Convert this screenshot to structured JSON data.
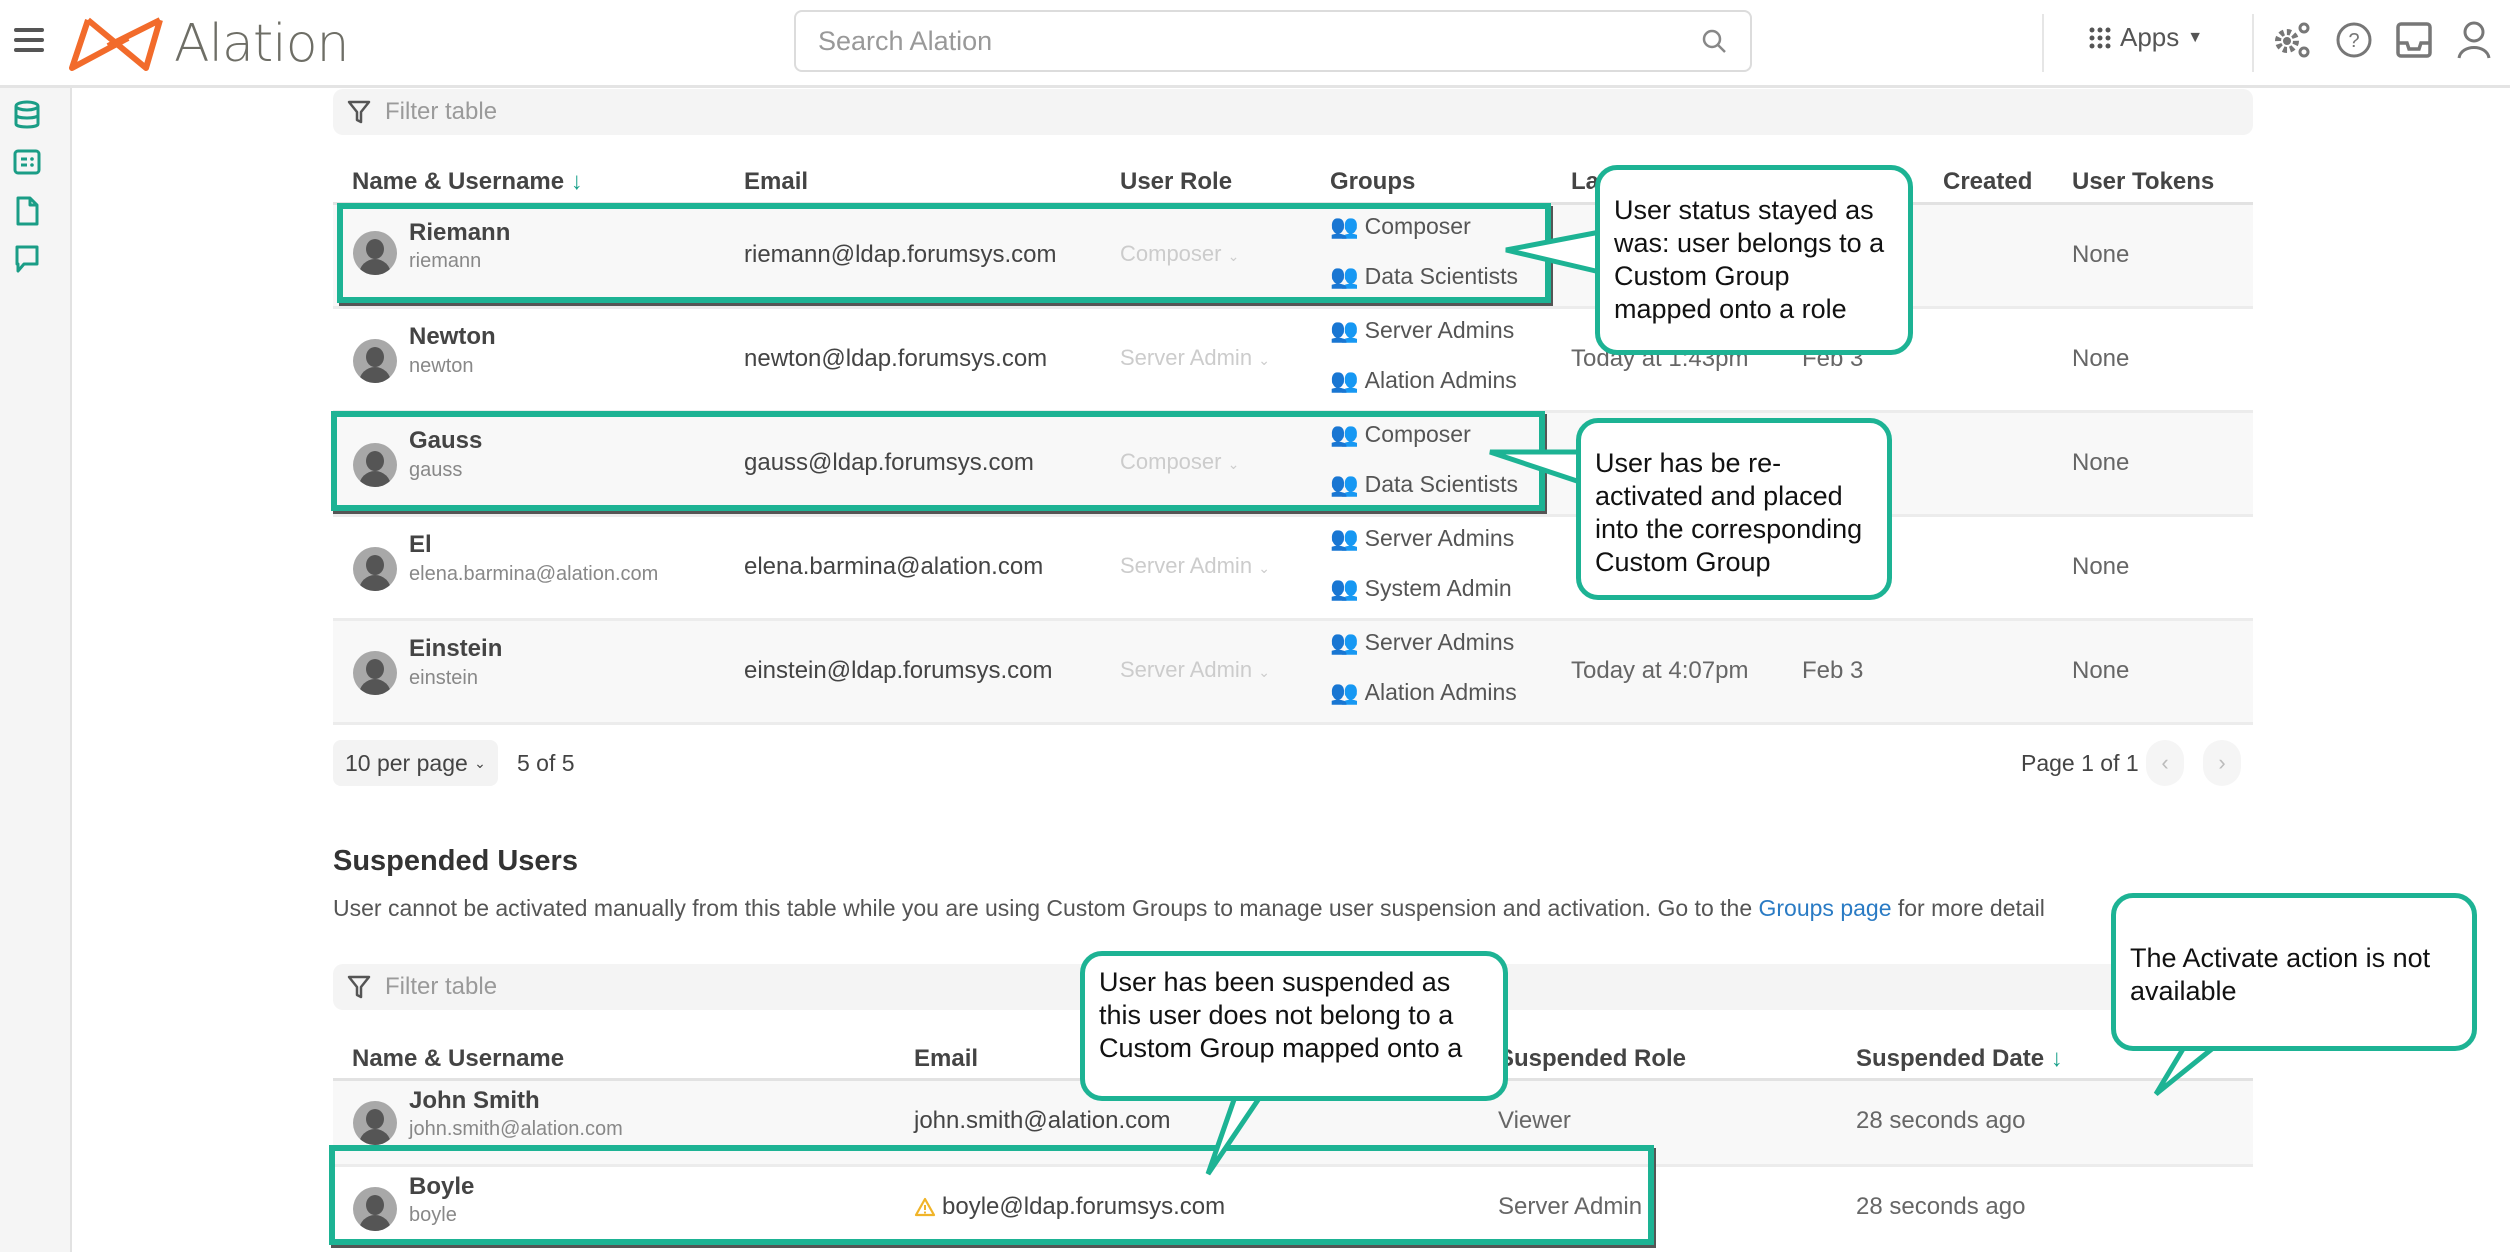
{
  "header": {
    "app_name": "Alation",
    "search_placeholder": "Search Alation",
    "apps_label": "Apps",
    "icons": [
      "menu-icon",
      "alation-logo",
      "search-icon",
      "apps-grid-icon",
      "caret-down-icon",
      "settings-gears-icon",
      "help-icon",
      "inbox-icon",
      "user-profile-icon"
    ]
  },
  "sidebar": {
    "icons": [
      "database-icon",
      "glossary-icon",
      "document-icon",
      "conversation-icon"
    ]
  },
  "active_users": {
    "filter_placeholder": "Filter table",
    "columns": [
      "Name & Username",
      "Email",
      "User Role",
      "Groups",
      "Last Login",
      "Created",
      "User Tokens"
    ],
    "visible_column_labels": {
      "name": "Name & Username",
      "email": "Email",
      "role": "User Role",
      "groups": "Groups",
      "last_login": "La",
      "created": "Created",
      "tokens": "User Tokens"
    },
    "sort_indicator": "↓",
    "rows": [
      {
        "name": "Riemann",
        "username": "riemann",
        "email": "riemann@ldap.forumsys.com",
        "role": "Composer",
        "groups": [
          "Composer",
          "Data Scientists"
        ],
        "last_login": "",
        "created": "",
        "tokens": "None"
      },
      {
        "name": "Newton",
        "username": "newton",
        "email": "newton@ldap.forumsys.com",
        "role": "Server Admin",
        "groups": [
          "Server Admins",
          "Alation Admins"
        ],
        "last_login": "Today at 1:43pm",
        "created": "Feb 3",
        "tokens": "None"
      },
      {
        "name": "Gauss",
        "username": "gauss",
        "email": "gauss@ldap.forumsys.com",
        "role": "Composer",
        "groups": [
          "Composer",
          "Data Scientists"
        ],
        "last_login": "",
        "created": "",
        "tokens": "None"
      },
      {
        "name": "El",
        "username": "elena.barmina@alation.com",
        "email": "elena.barmina@alation.com",
        "role": "Server Admin",
        "groups": [
          "Server Admins",
          "System Admin"
        ],
        "last_login": "",
        "created": "",
        "tokens": "None"
      },
      {
        "name": "Einstein",
        "username": "einstein",
        "email": "einstein@ldap.forumsys.com",
        "role": "Server Admin",
        "groups": [
          "Server Admins",
          "Alation Admins"
        ],
        "last_login": "Today at 4:07pm",
        "created": "Feb 3",
        "tokens": "None"
      }
    ],
    "pagination": {
      "per_page": "10 per page",
      "count": "5 of 5",
      "page_info": "Page 1 of 1",
      "prev": "‹",
      "next": "›"
    }
  },
  "suspended_users": {
    "title": "Suspended Users",
    "description_pre": "User cannot be activated manually from this table while you are using Custom Groups to manage user suspension and activation. Go to the ",
    "description_link": "Groups page",
    "description_post": " for more detail",
    "filter_placeholder": "Filter table",
    "columns": {
      "name": "Name & Username",
      "email": "Email",
      "role": "Suspended Role",
      "date": "Suspended Date"
    },
    "sort_indicator": "↓",
    "rows": [
      {
        "name": "John Smith",
        "username": "john.smith@alation.com",
        "email": "john.smith@alation.com",
        "warning": false,
        "role": "Viewer",
        "date": "28 seconds ago"
      },
      {
        "name": "Boyle",
        "username": "boyle",
        "email": "boyle@ldap.forumsys.com",
        "warning": true,
        "role": "Server Admin",
        "date": "28 seconds ago"
      }
    ]
  },
  "annotations": [
    {
      "text": "User status stayed as was: user belongs to a Custom Group mapped onto a role"
    },
    {
      "text": "User has be re-activated and placed into the corresponding Custom Group"
    },
    {
      "text": "User has been suspended as this user does not belong to a Custom Group mapped onto a"
    },
    {
      "text": "The Activate action is not available"
    }
  ],
  "colors": {
    "accent_teal": "#1db394",
    "brand_orange": "#f26b2b",
    "link_blue": "#2a7bc4",
    "warning_yellow": "#f0b429"
  }
}
